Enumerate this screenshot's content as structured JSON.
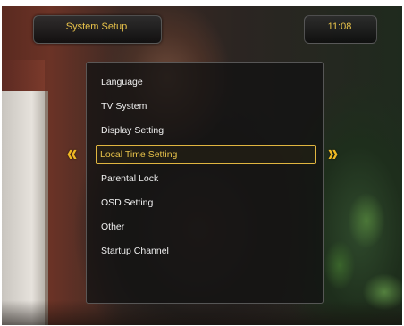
{
  "header": {
    "title": "System Setup",
    "time": "11:08"
  },
  "menu": {
    "items": [
      {
        "label": "Language"
      },
      {
        "label": "TV System"
      },
      {
        "label": "Display Setting"
      },
      {
        "label": "Local Time Setting",
        "selected": true
      },
      {
        "label": "Parental Lock"
      },
      {
        "label": "OSD Setting"
      },
      {
        "label": "Other"
      },
      {
        "label": "Startup Channel"
      }
    ]
  },
  "nav": {
    "left_arrow": "«",
    "right_arrow": "»"
  },
  "colors": {
    "accent": "#e8c24a",
    "arrow": "#f0b823",
    "text": "#f0f0f0"
  }
}
